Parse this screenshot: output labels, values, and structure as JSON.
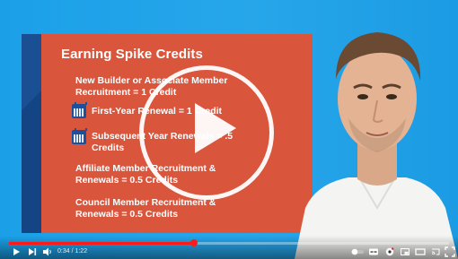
{
  "slide": {
    "title": "Earning Spike Credits",
    "items": [
      {
        "line1": "New Builder or Associate Member",
        "line2": "Recruitment = 1 Credit",
        "icon": ""
      },
      {
        "line1": "First-Year Renewal = 1 Credit",
        "line2": "",
        "icon": "calendar-icon"
      },
      {
        "line1": "Subsequent Year Renewals = .5",
        "line2": "Credits",
        "icon": "calendar-icon"
      },
      {
        "line1": "Affiliate Member Recruitment &",
        "line2": "Renewals = 0.5 Credits",
        "icon": ""
      },
      {
        "line1": "Council Member Recruitment &",
        "line2": "Renewals = 0.5 Credits",
        "icon": ""
      }
    ]
  },
  "player": {
    "time": "0:34 / 1:22",
    "progress_fraction": 0.42,
    "colors": {
      "accent": "#ff1a1a",
      "slide": "#d9553c",
      "band": "#1a4f93",
      "bg": "#1ba1e6"
    },
    "controls": [
      "play-icon",
      "next-icon",
      "volume-icon",
      "autoplay-toggle",
      "captions-icon",
      "settings-icon",
      "miniplayer-icon",
      "theater-icon",
      "cast-icon",
      "fullscreen-icon"
    ]
  }
}
